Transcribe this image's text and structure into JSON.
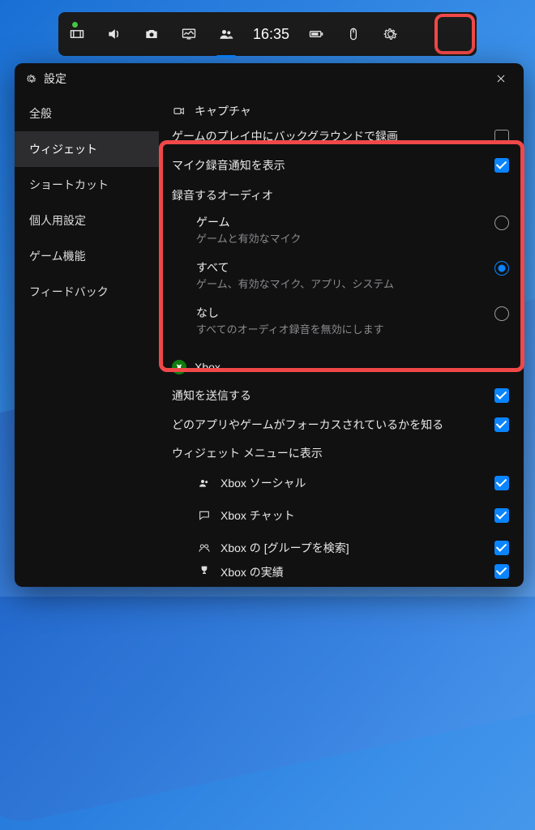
{
  "gamebar": {
    "clock": "16:35"
  },
  "header": {
    "title": "設定"
  },
  "sidebar": {
    "items": [
      "全般",
      "ウィジェット",
      "ショートカット",
      "個人用設定",
      "ゲーム機能",
      "フィードバック"
    ]
  },
  "content": {
    "capture_section": "キャプチャ",
    "bg_record": "ゲームのプレイ中にバックグラウンドで録画",
    "mic_notify": "マイク録音通知を表示",
    "audio_to_record": "録音するオーディオ",
    "audio_opts": [
      {
        "title": "ゲーム",
        "desc": "ゲームと有効なマイク",
        "selected": false
      },
      {
        "title": "すべて",
        "desc": "ゲーム、有効なマイク、アプリ、システム",
        "selected": true
      },
      {
        "title": "なし",
        "desc": "すべてのオーディオ録音を無効にします",
        "selected": false
      }
    ],
    "xbox_section": "Xbox",
    "xbox_notify": "通知を送信する",
    "xbox_focus": "どのアプリやゲームがフォーカスされているかを知る",
    "widget_menu": "ウィジェット メニューに表示",
    "widgets": [
      "Xbox ソーシャル",
      "Xbox チャット",
      "Xbox の [グループを検索]",
      "Xbox の実績"
    ]
  }
}
